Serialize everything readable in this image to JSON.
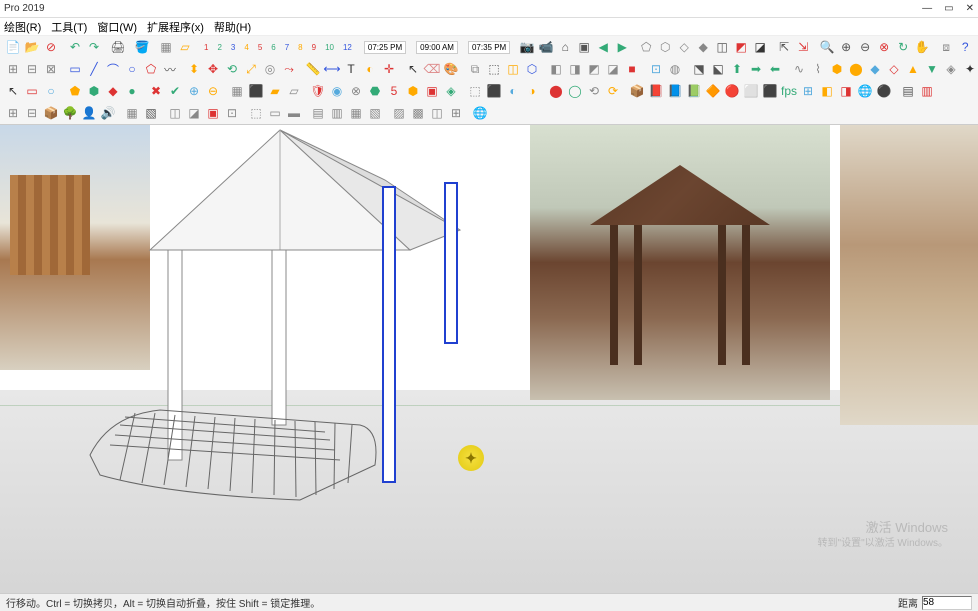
{
  "window": {
    "title": "Pro 2019",
    "controls": {
      "min": "—",
      "max": "▭",
      "close": "✕"
    }
  },
  "menu": {
    "items": [
      "绘图(R)",
      "工具(T)",
      "窗口(W)",
      "扩展程序(x)",
      "帮助(H)"
    ]
  },
  "scale_labels": [
    "1",
    "2",
    "3",
    "4",
    "5",
    "6",
    "7",
    "8",
    "9",
    "10",
    "12"
  ],
  "time": {
    "start": "07:25 PM",
    "noon": "09:00 AM",
    "end": "07:35 PM"
  },
  "status": {
    "hint": "行移动。Ctrl = 切换拷贝，Alt = 切换自动折叠，按住 Shift = 锁定推理。",
    "label": "距离",
    "value": "58"
  },
  "watermark": {
    "line1": "激活 Windows",
    "line2": "转到\"设置\"以激活 Windows。"
  },
  "toolbars": {
    "r1": [
      {
        "n": "new-icon",
        "c": "#333",
        "g": "📄"
      },
      {
        "n": "open-icon",
        "c": "#d4a017",
        "g": "📂"
      },
      {
        "n": "delete-icon",
        "c": "#d33",
        "g": "⊘"
      },
      {
        "sep": true
      },
      {
        "n": "undo-icon",
        "c": "#3a7",
        "g": "↶"
      },
      {
        "n": "redo-icon",
        "c": "#3a7",
        "g": "↷"
      },
      {
        "sep": true
      },
      {
        "n": "print-icon",
        "c": "#555",
        "g": "🖨"
      },
      {
        "sep": true
      },
      {
        "n": "paint-icon",
        "c": "#d33",
        "g": "🪣"
      },
      {
        "sep": true
      },
      {
        "n": "layers-icon",
        "c": "#888",
        "g": "▦"
      },
      {
        "n": "sheet-icon",
        "c": "#fa0",
        "g": "▱"
      }
    ],
    "r1b": [
      {
        "n": "cam1-icon",
        "c": "#333",
        "g": "📷"
      },
      {
        "n": "cam2-icon",
        "c": "#333",
        "g": "📹"
      },
      {
        "n": "home-icon",
        "c": "#555",
        "g": "⌂"
      },
      {
        "n": "cam3-icon",
        "c": "#555",
        "g": "▣"
      },
      {
        "n": "prev-icon",
        "c": "#3a7",
        "g": "◀"
      },
      {
        "n": "next-icon",
        "c": "#3a7",
        "g": "▶"
      },
      {
        "sep": true
      },
      {
        "n": "poly1-icon",
        "c": "#888",
        "g": "⬠"
      },
      {
        "n": "poly2-icon",
        "c": "#888",
        "g": "⬡"
      },
      {
        "n": "poly3-icon",
        "c": "#888",
        "g": "◇"
      },
      {
        "n": "poly4-icon",
        "c": "#888",
        "g": "◆"
      },
      {
        "n": "cube1-icon",
        "c": "#555",
        "g": "◫"
      },
      {
        "n": "cube2-icon",
        "c": "#d33",
        "g": "◩"
      },
      {
        "n": "cube3-icon",
        "c": "#333",
        "g": "◪"
      },
      {
        "sep": true
      },
      {
        "n": "import-icon",
        "c": "#555",
        "g": "⇱"
      },
      {
        "n": "export-icon",
        "c": "#d33",
        "g": "⇲"
      },
      {
        "sep": true
      },
      {
        "n": "zoom-icon",
        "c": "#555",
        "g": "🔍"
      },
      {
        "n": "zoomin-icon",
        "c": "#555",
        "g": "⊕"
      },
      {
        "n": "zoomout-icon",
        "c": "#555",
        "g": "⊖"
      },
      {
        "n": "target-icon",
        "c": "#d33",
        "g": "⊗"
      },
      {
        "n": "orbit-icon",
        "c": "#3a7",
        "g": "↻"
      },
      {
        "n": "pan-icon",
        "c": "#555",
        "g": "✋"
      },
      {
        "sep": true
      },
      {
        "n": "window-icon",
        "c": "#888",
        "g": "⧈"
      },
      {
        "n": "help-icon",
        "c": "#35d",
        "g": "?"
      },
      {
        "sep": true
      },
      {
        "n": "doc-icon",
        "c": "#888",
        "g": "📋"
      },
      {
        "n": "cloud-icon",
        "c": "#5ad",
        "g": "☁"
      },
      {
        "n": "box1-icon",
        "c": "#fa0",
        "g": "📦"
      },
      {
        "n": "box2-icon",
        "c": "#555",
        "g": "▢"
      },
      {
        "n": "tool1-icon",
        "c": "#888",
        "g": "⚙"
      },
      {
        "n": "tool2-icon",
        "c": "#d33",
        "g": "✦"
      },
      {
        "n": "tool3-icon",
        "c": "#3a7",
        "g": "✧"
      }
    ],
    "r2": [
      {
        "n": "grid1-icon",
        "c": "#888",
        "g": "⊞"
      },
      {
        "n": "grid2-icon",
        "c": "#888",
        "g": "⊟"
      },
      {
        "n": "grid3-icon",
        "c": "#888",
        "g": "⊠"
      },
      {
        "sep": true
      },
      {
        "n": "rect-icon",
        "c": "#35d",
        "g": "▭"
      },
      {
        "n": "line-icon",
        "c": "#35d",
        "g": "╱"
      },
      {
        "n": "arc-icon",
        "c": "#35d",
        "g": "⌒"
      },
      {
        "n": "circle-icon",
        "c": "#35d",
        "g": "○"
      },
      {
        "n": "poly-icon",
        "c": "#d33",
        "g": "⬠"
      },
      {
        "n": "free-icon",
        "c": "#555",
        "g": "〰"
      },
      {
        "sep": true
      },
      {
        "n": "push-icon",
        "c": "#fa0",
        "g": "⬍"
      },
      {
        "n": "move-icon",
        "c": "#d33",
        "g": "✥"
      },
      {
        "n": "rotate-icon",
        "c": "#3a7",
        "g": "⟲"
      },
      {
        "n": "scale-icon",
        "c": "#fa0",
        "g": "⤢"
      },
      {
        "n": "offset-icon",
        "c": "#888",
        "g": "◎"
      },
      {
        "n": "follow-icon",
        "c": "#d33",
        "g": "⤳"
      },
      {
        "sep": true
      },
      {
        "n": "tape-icon",
        "c": "#555",
        "g": "📏"
      },
      {
        "n": "dim-icon",
        "c": "#35d",
        "g": "⟷"
      },
      {
        "n": "text-icon",
        "c": "#333",
        "g": "T"
      },
      {
        "n": "protract-icon",
        "c": "#fa0",
        "g": "◐"
      },
      {
        "n": "axes-icon",
        "c": "#d33",
        "g": "✛"
      },
      {
        "sep": true
      },
      {
        "n": "sel-icon",
        "c": "#333",
        "g": "↖"
      },
      {
        "n": "erase-icon",
        "c": "#d88",
        "g": "⌫"
      },
      {
        "n": "bucket-icon",
        "c": "#fa0",
        "g": "🎨"
      },
      {
        "sep": true
      },
      {
        "n": "comp-icon",
        "c": "#888",
        "g": "⧉"
      },
      {
        "n": "group-icon",
        "c": "#555",
        "g": "⬚"
      },
      {
        "n": "sect-icon",
        "c": "#fa0",
        "g": "◫"
      },
      {
        "n": "wire-icon",
        "c": "#35d",
        "g": "⬡"
      },
      {
        "sep": true
      },
      {
        "n": "face1-icon",
        "c": "#888",
        "g": "◧"
      },
      {
        "n": "face2-icon",
        "c": "#888",
        "g": "◨"
      },
      {
        "n": "face3-icon",
        "c": "#888",
        "g": "◩"
      },
      {
        "n": "face4-icon",
        "c": "#888",
        "g": "◪"
      },
      {
        "n": "fill-icon",
        "c": "#d33",
        "g": "■"
      },
      {
        "sep": true
      },
      {
        "n": "xray-icon",
        "c": "#5ad",
        "g": "⊡"
      },
      {
        "n": "shade-icon",
        "c": "#888",
        "g": "◍"
      },
      {
        "sep": true
      },
      {
        "n": "pers-icon",
        "c": "#555",
        "g": "⬔"
      },
      {
        "n": "iso-icon",
        "c": "#555",
        "g": "⬕"
      },
      {
        "n": "top-icon",
        "c": "#3a7",
        "g": "⬆"
      },
      {
        "n": "front-icon",
        "c": "#3a7",
        "g": "➡"
      },
      {
        "n": "side-icon",
        "c": "#3a7",
        "g": "⬅"
      },
      {
        "sep": true
      },
      {
        "n": "curve1-icon",
        "c": "#888",
        "g": "∿"
      },
      {
        "n": "curve2-icon",
        "c": "#888",
        "g": "⌇"
      },
      {
        "n": "box3d-icon",
        "c": "#fa0",
        "g": "⬢"
      },
      {
        "n": "cyl-icon",
        "c": "#fa0",
        "g": "⬤"
      },
      {
        "n": "ext1-icon",
        "c": "#5ad",
        "g": "◆"
      },
      {
        "n": "ext2-icon",
        "c": "#d33",
        "g": "◇"
      },
      {
        "n": "ext3-icon",
        "c": "#fa0",
        "g": "▲"
      },
      {
        "n": "ext4-icon",
        "c": "#3a7",
        "g": "▼"
      },
      {
        "n": "ext5-icon",
        "c": "#888",
        "g": "◈"
      },
      {
        "n": "ext6-icon",
        "c": "#333",
        "g": "✦"
      },
      {
        "n": "ext7-icon",
        "c": "#d33",
        "g": "★"
      },
      {
        "n": "ext8-icon",
        "c": "#5ad",
        "g": "☆"
      },
      {
        "n": "ext9-icon",
        "c": "#fa0",
        "g": "⬟"
      },
      {
        "n": "ext10-icon",
        "c": "#3a7",
        "g": "⬠"
      }
    ],
    "r3": [
      {
        "n": "sel2-icon",
        "c": "#333",
        "g": "↖"
      },
      {
        "n": "r3b-icon",
        "c": "#d33",
        "g": "▭"
      },
      {
        "n": "r3c-icon",
        "c": "#5ad",
        "g": "○"
      },
      {
        "sep": true
      },
      {
        "n": "r3d-icon",
        "c": "#fa0",
        "g": "⬟"
      },
      {
        "n": "r3e-icon",
        "c": "#3a7",
        "g": "⬢"
      },
      {
        "n": "r3f-icon",
        "c": "#d33",
        "g": "◆"
      },
      {
        "n": "r3g-icon",
        "c": "#3a7",
        "g": "●"
      },
      {
        "sep": true
      },
      {
        "n": "r3h-icon",
        "c": "#d33",
        "g": "✖"
      },
      {
        "n": "r3i-icon",
        "c": "#3a7",
        "g": "✔"
      },
      {
        "n": "r3j-icon",
        "c": "#5ad",
        "g": "⊕"
      },
      {
        "n": "r3k-icon",
        "c": "#fa0",
        "g": "⊖"
      },
      {
        "sep": true
      },
      {
        "n": "r3l-icon",
        "c": "#888",
        "g": "▦"
      },
      {
        "n": "r3m-icon",
        "c": "#d33",
        "g": "⬛"
      },
      {
        "n": "r3n-icon",
        "c": "#fa0",
        "g": "▰"
      },
      {
        "n": "r3o-icon",
        "c": "#888",
        "g": "▱"
      },
      {
        "sep": true
      },
      {
        "n": "r3p-icon",
        "c": "#d33",
        "g": "🛡"
      },
      {
        "n": "r3q-icon",
        "c": "#5ad",
        "g": "◉"
      },
      {
        "n": "r3r-icon",
        "c": "#888",
        "g": "⊗"
      },
      {
        "n": "r3s-icon",
        "c": "#3a7",
        "g": "⬣"
      },
      {
        "n": "r3t-icon",
        "c": "#d33",
        "g": "5"
      },
      {
        "n": "r3u-icon",
        "c": "#fa0",
        "g": "⬢"
      },
      {
        "n": "r3v-icon",
        "c": "#d33",
        "g": "▣"
      },
      {
        "n": "r3w-icon",
        "c": "#3a7",
        "g": "◈"
      },
      {
        "sep": true
      },
      {
        "n": "r3x-icon",
        "c": "#888",
        "g": "⬚"
      },
      {
        "n": "r3y-icon",
        "c": "#333",
        "g": "⬛"
      },
      {
        "n": "r3z-icon",
        "c": "#5ad",
        "g": "◐"
      },
      {
        "n": "r3aa-icon",
        "c": "#fa0",
        "g": "◑"
      },
      {
        "sep": true
      },
      {
        "n": "r3ab-icon",
        "c": "#d33",
        "g": "⬤"
      },
      {
        "n": "r3ac-icon",
        "c": "#3a7",
        "g": "◯"
      },
      {
        "n": "r3ad-icon",
        "c": "#888",
        "g": "⟲"
      },
      {
        "n": "r3ae-icon",
        "c": "#fa0",
        "g": "⟳"
      },
      {
        "sep": true
      },
      {
        "n": "r3af-icon",
        "c": "#fa0",
        "g": "📦"
      },
      {
        "n": "r3ag-icon",
        "c": "#d33",
        "g": "📕"
      },
      {
        "n": "r3ah-icon",
        "c": "#5ad",
        "g": "📘"
      },
      {
        "n": "r3ai-icon",
        "c": "#3a7",
        "g": "📗"
      },
      {
        "n": "r3aj-icon",
        "c": "#fa0",
        "g": "🔶"
      },
      {
        "n": "r3ak-icon",
        "c": "#d33",
        "g": "🔴"
      },
      {
        "n": "r3al-icon",
        "c": "#888",
        "g": "⬜"
      },
      {
        "n": "r3am-icon",
        "c": "#333",
        "g": "⬛"
      },
      {
        "n": "fps-icon",
        "c": "#3a7",
        "g": "fps"
      },
      {
        "n": "r3an-icon",
        "c": "#5ad",
        "g": "⊞"
      },
      {
        "n": "r3ao-icon",
        "c": "#fa0",
        "g": "◧"
      },
      {
        "n": "r3ap-icon",
        "c": "#d33",
        "g": "◨"
      },
      {
        "n": "r3aq-icon",
        "c": "#3a7",
        "g": "🌐"
      },
      {
        "n": "r3ar-icon",
        "c": "#888",
        "g": "⚫"
      },
      {
        "sep": true
      },
      {
        "n": "r3as-icon",
        "c": "#555",
        "g": "▤"
      },
      {
        "n": "r3at-icon",
        "c": "#d33",
        "g": "▥"
      }
    ],
    "r4": [
      {
        "n": "r4a-icon",
        "c": "#888",
        "g": "⊞"
      },
      {
        "n": "r4b-icon",
        "c": "#888",
        "g": "⊟"
      },
      {
        "n": "r4c-icon",
        "c": "#fa0",
        "g": "📦"
      },
      {
        "n": "r4d-icon",
        "c": "#3a7",
        "g": "🌳"
      },
      {
        "n": "r4e-icon",
        "c": "#555",
        "g": "👤"
      },
      {
        "n": "r4f-icon",
        "c": "#888",
        "g": "🔊"
      },
      {
        "sep": true
      },
      {
        "n": "r4g-icon",
        "c": "#888",
        "g": "▦"
      },
      {
        "n": "r4h-icon",
        "c": "#555",
        "g": "▧"
      },
      {
        "sep": true
      },
      {
        "n": "r4i-icon",
        "c": "#888",
        "g": "◫"
      },
      {
        "n": "r4j-icon",
        "c": "#888",
        "g": "◪"
      },
      {
        "n": "r4k-icon",
        "c": "#d33",
        "g": "▣"
      },
      {
        "n": "r4l-icon",
        "c": "#888",
        "g": "⊡"
      },
      {
        "sep": true
      },
      {
        "n": "r4m-icon",
        "c": "#888",
        "g": "⬚"
      },
      {
        "n": "r4n-icon",
        "c": "#888",
        "g": "▭"
      },
      {
        "n": "r4o-icon",
        "c": "#888",
        "g": "▬"
      },
      {
        "sep": true
      },
      {
        "n": "r4p-icon",
        "c": "#888",
        "g": "▤"
      },
      {
        "n": "r4q-icon",
        "c": "#888",
        "g": "▥"
      },
      {
        "n": "r4r-icon",
        "c": "#888",
        "g": "▦"
      },
      {
        "n": "r4s-icon",
        "c": "#888",
        "g": "▧"
      },
      {
        "sep": true
      },
      {
        "n": "r4t-icon",
        "c": "#888",
        "g": "▨"
      },
      {
        "n": "r4u-icon",
        "c": "#888",
        "g": "▩"
      },
      {
        "n": "r4v-icon",
        "c": "#888",
        "g": "◫"
      },
      {
        "n": "r4w-icon",
        "c": "#888",
        "g": "⊞"
      },
      {
        "sep": true
      },
      {
        "n": "r4x-icon",
        "c": "#888",
        "g": "🌐"
      }
    ]
  }
}
